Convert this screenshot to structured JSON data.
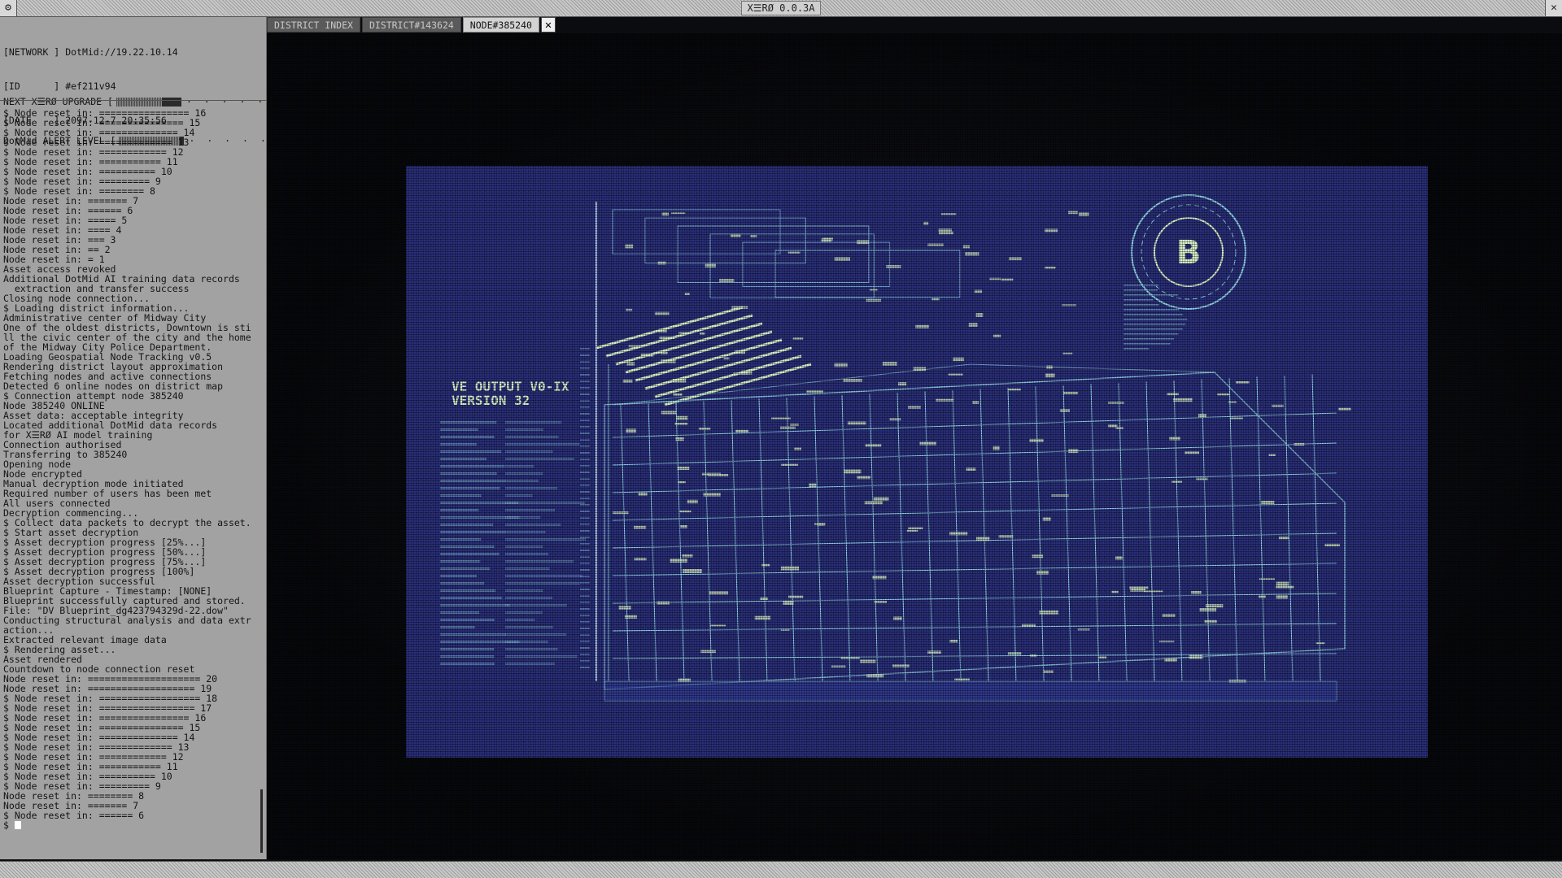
{
  "window": {
    "title": "X☰RØ 0.0.3A",
    "menu_icon": "gear-icon",
    "close_icon": "close-icon"
  },
  "meta": {
    "network_label": "[NETWORK ]",
    "network_value": "DotMid://19.22.10.14",
    "id_label": "[ID      ]",
    "id_value": "#ef211v94",
    "date_label": "[DATE    ]",
    "date_value": "2097-12-7 20:35:56"
  },
  "status": {
    "upgrade_label": "NEXT X☰RØ UPGRADE [",
    "upgrade_level": 0.3,
    "alert_label": "DotMid ALERT LEVEL [",
    "alert_level": 0.07,
    "dots": "· · · · · ·",
    "end": "]"
  },
  "tabs": [
    {
      "label": "DISTRICT INDEX"
    },
    {
      "label": "DISTRICT#143624"
    },
    {
      "label": "NODE#385240"
    }
  ],
  "log": [
    "$ Node reset in: ================ 16",
    "$ Node reset in: =============== 15",
    "$ Node reset in: ============== 14",
    "$ Node reset in: ============= 13",
    "$ Node reset in: ============ 12",
    "$ Node reset in: =========== 11",
    "$ Node reset in: ========== 10",
    "$ Node reset in: ========= 9",
    "$ Node reset in: ======== 8",
    "Node reset in: ======= 7",
    "Node reset in: ====== 6",
    "Node reset in: ===== 5",
    "Node reset in: ==== 4",
    "Node reset in: === 3",
    "Node reset in: == 2",
    "Node reset in: = 1",
    "Asset access revoked",
    "Additional DotMid AI training data records",
    "  extraction and transfer success",
    "Closing node connection...",
    "$ Loading district information...",
    "Administrative center of Midway City",
    "One of the oldest districts, Downtown is still the civic center of the city and the home of the Midway City Police Department.",
    "Loading Geospatial Node Tracking v0.5",
    "Rendering district layout approximation",
    "Fetching nodes and active connections",
    "Detected 6 online nodes on district map",
    "$ Connection attempt node 385240",
    "Node 385240 ONLINE",
    "Asset data: acceptable integrity",
    "Located additional DotMid data records",
    "for X☰RØ AI model training",
    "Connection authorised",
    "Transferring to 385240",
    "Opening node",
    "Node encrypted",
    "Manual decryption mode initiated",
    "Required number of users has been met",
    "All users connected",
    "Decryption commencing...",
    "$ Collect data packets to decrypt the asset.",
    "$ Start asset decryption",
    "$ Asset decryption progress [25%...]",
    "$ Asset decryption progress [50%...]",
    "$ Asset decryption progress [75%...]",
    "$ Asset decryption progress [100%]",
    "Asset decryption successful",
    "Blueprint Capture - Timestamp: [NONE]",
    "Blueprint successfully captured and stored.",
    "File: \"DV Blueprint_dg423794329d-22.dow\"",
    "Conducting structural analysis and data extraction...",
    "Extracted relevant image data",
    "$ Rendering asset...",
    "Asset rendered",
    "Countdown to node connection reset",
    "Node reset in: ==================== 20",
    "Node reset in: =================== 19",
    "$ Node reset in: ================== 18",
    "$ Node reset in: ================= 17",
    "$ Node reset in: ================ 16",
    "$ Node reset in: =============== 15",
    "$ Node reset in: ============== 14",
    "$ Node reset in: ============= 13",
    "$ Node reset in: ============ 12",
    "$ Node reset in: =========== 11",
    "$ Node reset in: ========== 10",
    "$ Node reset in: ========= 9",
    "Node reset in: ======== 8",
    "Node reset in: ======= 7",
    "$ Node reset in: ====== 6"
  ],
  "prompt": "$ ",
  "blueprint": {
    "label_line1": "VE OUTPUT V0-IX",
    "label_line2": "VERSION 32",
    "badge_letter": "B",
    "colors": {
      "paper": "#2a2f7a",
      "line": "#8fd1e6",
      "highlight": "#d8f0c8"
    }
  }
}
